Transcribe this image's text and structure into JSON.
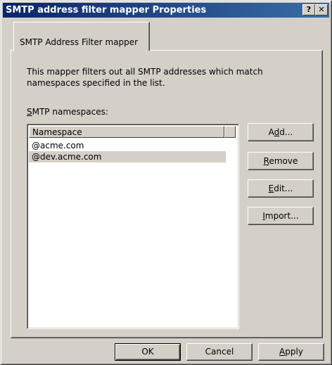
{
  "window": {
    "title": "SMTP address filter mapper Properties",
    "help_button": "?",
    "close_button": "✕"
  },
  "tabs": [
    {
      "label": "SMTP Address Filter mapper",
      "selected": true
    }
  ],
  "panel": {
    "description_line1": "This mapper filters out all SMTP addresses which match",
    "description_line2": "namespaces specified in the list.",
    "namespaces_label_mnemonic": "S",
    "namespaces_label_rest": "MTP namespaces:",
    "list": {
      "column_header": "Namespace",
      "rows": [
        {
          "value": "@acme.com",
          "selected": false
        },
        {
          "value": "@dev.acme.com",
          "selected": true
        }
      ]
    },
    "buttons": {
      "add_pre": "A",
      "add_mnemonic": "d",
      "add_post": "d...",
      "remove_mnemonic": "R",
      "remove_post": "emove",
      "edit_mnemonic": "E",
      "edit_post": "dit...",
      "import_mnemonic": "I",
      "import_post": "mport..."
    }
  },
  "footer": {
    "ok": "OK",
    "cancel": "Cancel",
    "apply_mnemonic": "A",
    "apply_post": "pply"
  },
  "colors": {
    "titlebar_start": "#0a246a",
    "titlebar_end": "#3a6ea5",
    "face": "#d4d0c8"
  }
}
